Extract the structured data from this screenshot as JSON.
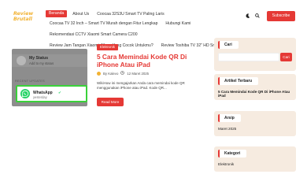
{
  "header": {
    "logo_line1": "Review",
    "logo_line2": "Brutall",
    "subscribe_label": "Subscribe",
    "nav_rows": [
      [
        "Beranda",
        "About Us",
        "Coocaa 32S3U Smart TV Paling Laris"
      ],
      [
        "Coocaa TV 32 Inch – Smart TV Murah dengan Fitur Lengkap",
        "Hubungi Kami"
      ],
      [
        "Rekomendasi CCTV Xiaomi Smart Camera C200"
      ],
      [
        "Review Jam Tangan Xiaomi, Mana Yang Cocok Untukmu?",
        "Review Toshiba TV 32” HD Smart TV"
      ]
    ],
    "icons": [
      "moon-icon",
      "search-icon"
    ]
  },
  "post": {
    "category": "Elektronik",
    "title": "5 Cara Memindai Kode QR Di iPhone Atau iPad",
    "author": "By Kalevo",
    "date": "12 Maret 2025",
    "excerpt": "WikiHow ini mengajarkan Anda cara memindai kode QR menggunakan iPhone atau iPad. Kode QR...",
    "read_more": "Read More",
    "thumbnail": {
      "my_status_title": "My Status",
      "my_status_sub": "Add to my status",
      "recent_label": "RECENT UPDATES",
      "whatsapp_name": "WhatsApp",
      "whatsapp_time": "yesterday"
    }
  },
  "sidebar": {
    "search_title": "Cari",
    "search_placeholder": "",
    "search_button": "Cari",
    "recent_title": "Artikel Terbaru",
    "recent_item": "5 Cara Memindai Kode QR Di iPhone Atau iPad",
    "archive_title": "Arsip",
    "archive_item": "Maret 2025",
    "category_title": "Kategori",
    "category_item": "Elektronik"
  },
  "colors": {
    "accent": "#e53935",
    "logo": "#f2b233",
    "sidebar_bg": "#f6ebe0",
    "whatsapp": "#25d366",
    "highlight": "#3ad13a"
  }
}
